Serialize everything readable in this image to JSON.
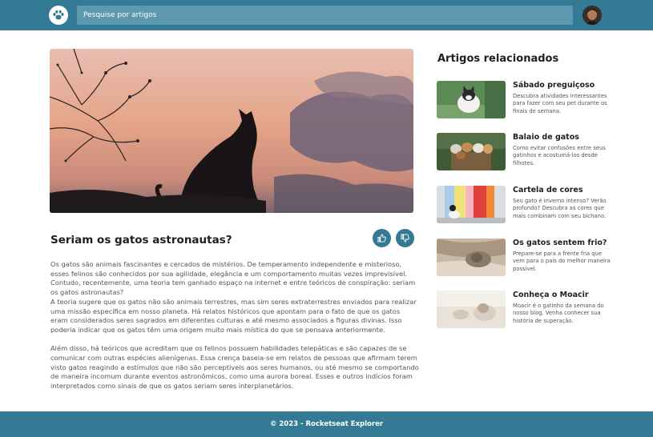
{
  "header": {
    "search_placeholder": "Pesquise por artigos",
    "logo_icon": "paw-icon",
    "avatar_icon": "user-avatar"
  },
  "article": {
    "title": "Seriam os gatos astronautas?",
    "paragraphs": [
      "Os gatos são animais fascinantes e cercados de mistérios. De temperamento independente e misterioso, esses felinos são conhecidos por sua agilidade, elegância e um comportamento muitas vezes imprevisível. Contudo, recentemente, uma teoria tem ganhado espaço na internet e entre teóricos de conspiração: seriam os gatos astronautas?",
      "A teoria sugere que os gatos não são animais terrestres, mas sim seres extraterrestres enviados para realizar uma missão específica em nosso planeta. Há relatos históricos que apontam para o fato de que os gatos eram considerados seres sagrados em diferentes culturas e até mesmo associados a figuras divinas. Isso poderia indicar que os gatos têm uma origem muito mais mística do que se pensava anteriormente.",
      "Além disso, há teóricos que acreditam que os felinos possuem habilidades telepáticas e são capazes de se comunicar com outras espécies alienígenas. Essa crença baseia-se em relatos de pessoas que afirmam terem visto gatos reagindo a estímulos que não são perceptíveis aos seres humanos, ou até mesmo se comportando de maneira incomum durante eventos astronômicos, como uma aurora boreal. Esses e outros indícios foram interpretados como sinais de que os gatos seriam seres interplanetários."
    ],
    "like_icon": "thumbs-up-icon",
    "dislike_icon": "thumbs-down-icon"
  },
  "sidebar": {
    "title": "Artigos relacionados",
    "items": [
      {
        "title": "Sábado preguiçoso",
        "description": "Descubra atividades interessantes para fazer com seu pet durante os finais de semana."
      },
      {
        "title": "Balaio de gatos",
        "description": "Como evitar confusões entre seus gatinhos e acostumá-los desde filhotes."
      },
      {
        "title": "Cartela de cores",
        "description": "Seu gato é inverno intenso? Verão profundo? Descubra as cores que mais combinam com seu bichano."
      },
      {
        "title": "Os gatos sentem frio?",
        "description": "Prepare-se para a frente fria que vem para o país do melhor maneira possível."
      },
      {
        "title": "Conheça o Moacir",
        "description": "Moacir é o gatinho da semana do nosso blog. Venha conhecer sua história de superação."
      }
    ]
  },
  "footer": {
    "text": "© 2023 - Rocketseat Explorer"
  },
  "colors": {
    "primary": "#357a95",
    "search_bg": "#5c98ae"
  }
}
